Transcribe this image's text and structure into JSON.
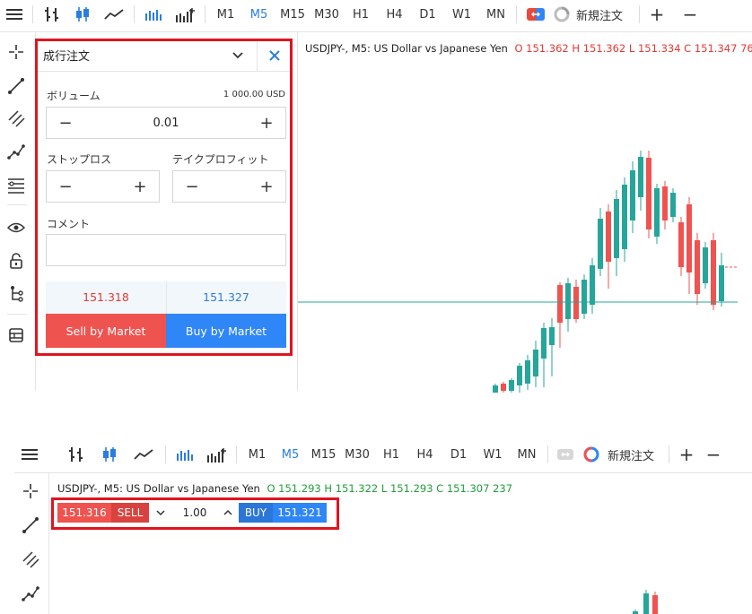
{
  "top": {
    "toolbar": {
      "timeframes": [
        "M1",
        "M5",
        "M15",
        "M30",
        "H1",
        "H4",
        "D1",
        "W1",
        "MN"
      ],
      "active_timeframe": "M5",
      "new_order_label": "新規注文",
      "plus": "+",
      "minus": "−"
    },
    "order_panel": {
      "title": "成行注文",
      "volume_label": "ボリューム",
      "volume_usd": "1 000.00 USD",
      "volume_value": "0.01",
      "stop_loss_label": "ストップロス",
      "take_profit_label": "テイクプロフィット",
      "comment_label": "コメント",
      "bid": "151.318",
      "ask": "151.327",
      "sell_label": "Sell by Market",
      "buy_label": "Buy by Market"
    },
    "chart": {
      "symbol": "USDJPY-, M5: US Dollar vs Japanese Yen",
      "ohlc": "O 151.362 H 151.362 L 151.334 C 151.347 76"
    }
  },
  "bottom": {
    "toolbar": {
      "timeframes": [
        "M1",
        "M5",
        "M15",
        "M30",
        "H1",
        "H4",
        "D1",
        "W1",
        "MN"
      ],
      "active_timeframe": "M5",
      "new_order_label": "新規注文",
      "plus": "+",
      "minus": "−"
    },
    "chart": {
      "symbol": "USDJPY-, M5: US Dollar vs Japanese Yen",
      "ohlc": "O 151.293 H 151.322 L 151.293 C 151.307 237"
    },
    "one_click": {
      "bid": "151.316",
      "sell": "SELL",
      "volume": "1.00",
      "buy": "BUY",
      "ask": "151.321"
    }
  },
  "colors": {
    "accent": "#2a7de1",
    "sell": "#ef5350",
    "buy": "#2f86f6",
    "bull": "#26a69a",
    "bear": "#ef5350",
    "highlight": "#e0141e"
  }
}
